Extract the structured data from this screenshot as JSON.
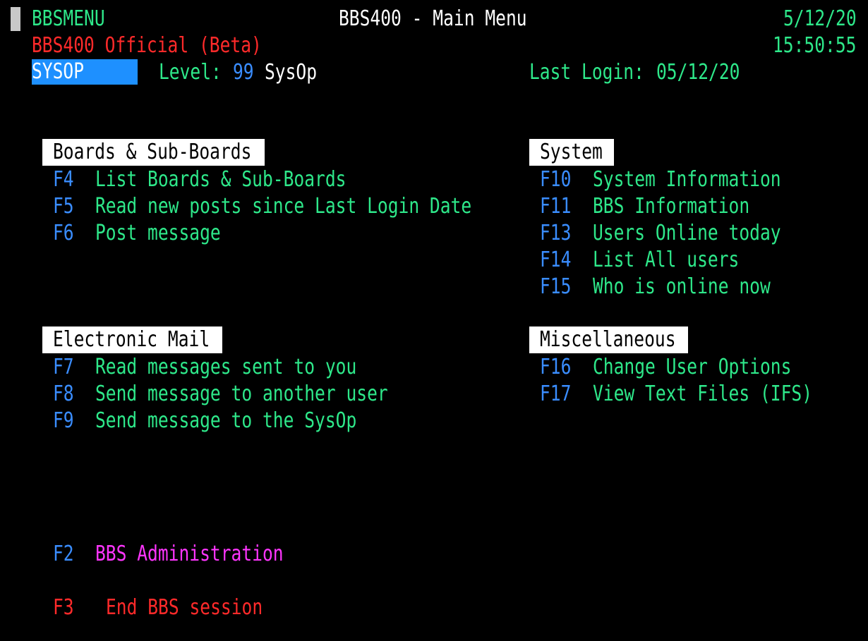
{
  "header": {
    "program": "BBSMENU",
    "title": "BBS400 - Main Menu",
    "date": "5/12/20",
    "subtitle": "BBS400 Official (Beta)",
    "time": "15:50:55",
    "user": "SYSOP",
    "level_label": "Level:",
    "level_value": "99",
    "level_name": "SysOp",
    "last_login_label": "Last Login:",
    "last_login_value": "05/12/20"
  },
  "sections": {
    "boards": {
      "title": "Boards & Sub-Boards",
      "items": [
        {
          "key": "F4",
          "label": "List Boards & Sub-Boards"
        },
        {
          "key": "F5",
          "label": "Read new posts since Last Login Date"
        },
        {
          "key": "F6",
          "label": "Post message"
        }
      ]
    },
    "system": {
      "title": "System",
      "items": [
        {
          "key": "F10",
          "label": "System Information"
        },
        {
          "key": "F11",
          "label": "BBS Information"
        },
        {
          "key": "F13",
          "label": "Users Online today"
        },
        {
          "key": "F14",
          "label": "List All users"
        },
        {
          "key": "F15",
          "label": "Who is online now"
        }
      ]
    },
    "mail": {
      "title": "Electronic Mail",
      "items": [
        {
          "key": "F7",
          "label": "Read messages sent to you"
        },
        {
          "key": "F8",
          "label": "Send message to another user"
        },
        {
          "key": "F9",
          "label": "Send message to the SysOp"
        }
      ]
    },
    "misc": {
      "title": "Miscellaneous",
      "items": [
        {
          "key": "F16",
          "label": "Change User Options"
        },
        {
          "key": "F17",
          "label": "View Text Files (IFS)"
        }
      ]
    }
  },
  "admin": {
    "key": "F2",
    "label": "BBS Administration"
  },
  "end_session": {
    "key": "F3",
    "label": "End BBS session"
  },
  "colors": {
    "green": "#2ee88a",
    "blue": "#3a8dff",
    "red": "#ff2a2a",
    "magenta": "#ff35ff",
    "white": "#ffffff",
    "field_bg": "#1e90ff"
  }
}
